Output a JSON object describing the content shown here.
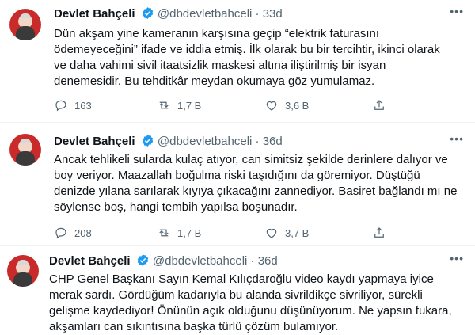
{
  "tweets": [
    {
      "name": "Devlet Bahçeli",
      "handle": "@dbdevletbahceli",
      "dot": "·",
      "time": "33d",
      "text": "Dün akşam yine kameranın karşısına geçip “elektrik faturasını\nödemeyeceğini” ifade ve iddia etmiş. İlk olarak bu bir tercihtir, ikinci olarak\nve daha vahimi sivil itaatsizlik maskesi altına iliştirilmiş bir isyan\ndenemesidir. Bu tehditkâr meydan okumaya göz yumulamaz.",
      "replies": "163",
      "retweets": "1,7 B",
      "likes": "3,6 B"
    },
    {
      "name": "Devlet Bahçeli",
      "handle": "@dbdevletbahceli",
      "dot": "·",
      "time": "36d",
      "text": "Ancak tehlikeli sularda kulaç atıyor, can simitsiz şekilde derinlere dalıyor ve\nboy veriyor. Maazallah boğulma riski taşıdığını da göremiyor. Düştüğü\ndenizde yılana sarılarak kıyıya çıkacağını zannediyor. Basiret bağlandı mı ne\nsöylense boş, hangi tembih yapılsa boşunadır.",
      "replies": "208",
      "retweets": "1,7 B",
      "likes": "3,7 B"
    },
    {
      "name": "Devlet Bahçeli",
      "handle": "@dbdevletbahceli",
      "dot": "·",
      "time": "36d",
      "text": "CHP Genel Başkanı Sayın Kemal Kılıçdaroğlu video kaydı yapmaya iyice\nmerak sardı. Gördüğüm kadarıyla bu alanda sivrildikçe sivriliyor, sürekli\ngelişme kaydediyor! Önünün açık olduğunu düşünüyorum. Ne yapsın fukara,\nakşamları can sıkıntısına başka türlü çözüm bulamıyor."
    }
  ],
  "colors": {
    "text": "#0f1419",
    "muted": "#536471",
    "verified": "#1d9bf0",
    "divider": "#eff3f4"
  },
  "icons": [
    "verified-badge-icon",
    "more-icon",
    "reply-icon",
    "retweet-icon",
    "like-icon",
    "share-icon"
  ]
}
